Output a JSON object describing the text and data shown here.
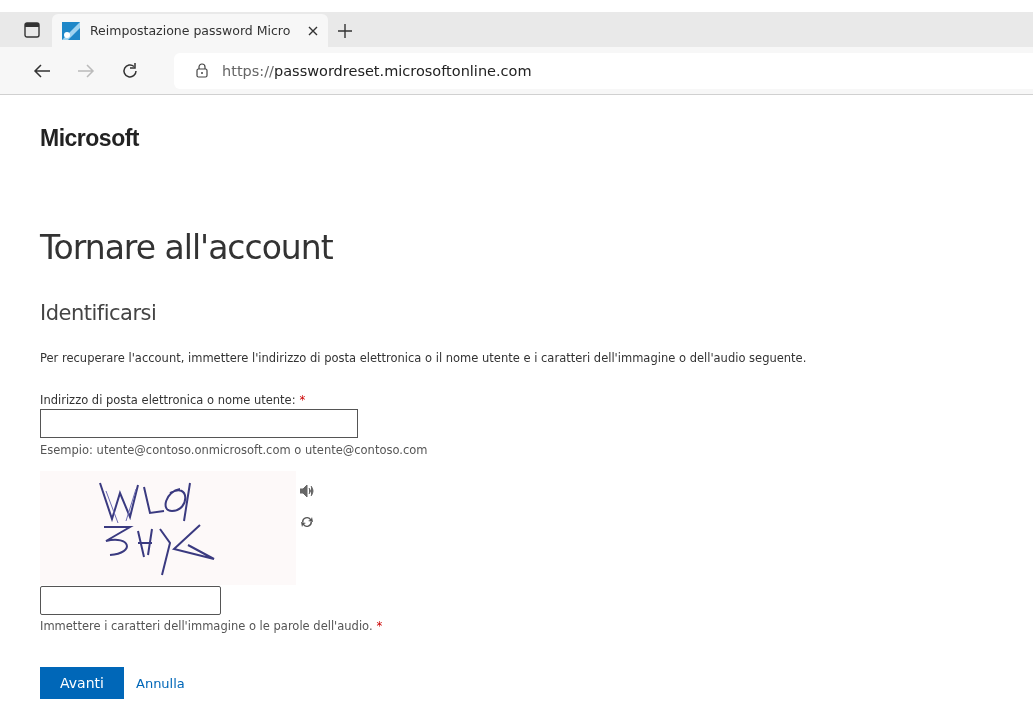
{
  "browser": {
    "tabs": [
      {
        "title": "Reimpostazione password Micro",
        "selected": true
      }
    ],
    "url_scheme": "https://",
    "url_host": "passwordreset.microsoftonline.com"
  },
  "page": {
    "logo": "Microsoft",
    "title": "Tornare all'account",
    "subtitle": "Identificarsi",
    "intro": "Per recuperare l'account, immettere l'indirizzo di posta elettronica o il nome utente e i caratteri dell'immagine o dell'audio seguente.",
    "fields": [
      {
        "kind": "email",
        "label": "Indirizzo di posta elettronica o nome utente:",
        "required_mark": "*",
        "hint": "Esempio: utente@contoso.onmicrosoft.com o utente@contoso.com"
      },
      {
        "kind": "captcha",
        "label": "Immettere i caratteri dell'immagine o le parole dell'audio.",
        "required_mark": "*"
      }
    ],
    "buttons": [
      {
        "kind": "primary",
        "label": "Avanti"
      },
      {
        "kind": "link",
        "label": "Annulla"
      }
    ]
  }
}
